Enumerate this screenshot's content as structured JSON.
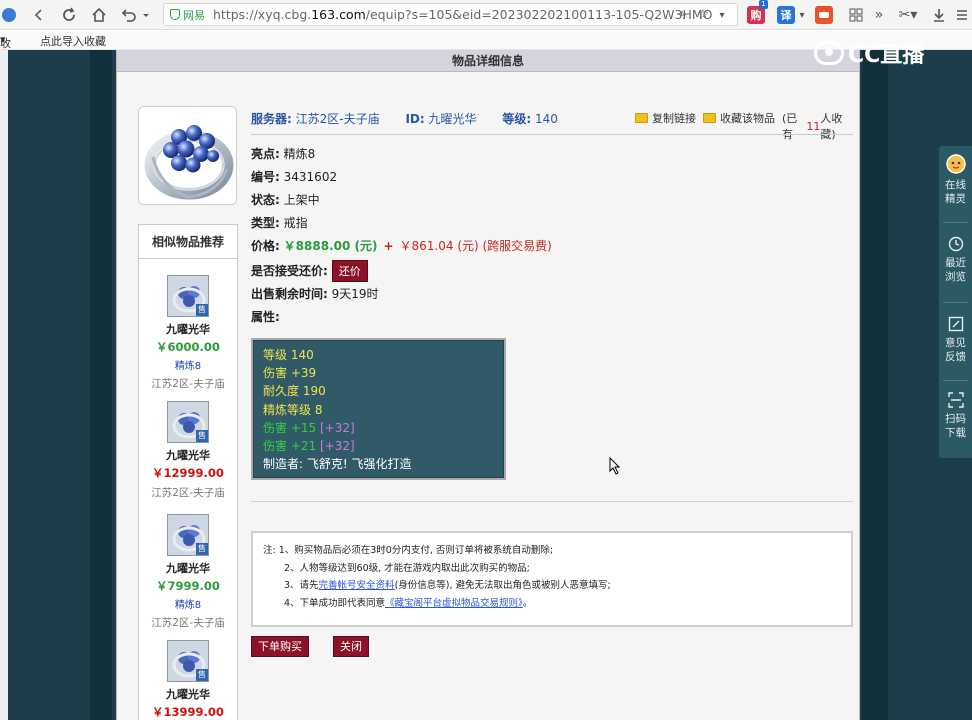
{
  "browser": {
    "url_secure_label": "网易",
    "url_host": "https://xyq.cbg.",
    "url_domain": "163.com",
    "url_path": "/equip?s=105&eid=202302202100113-105-Q2W3HMO",
    "ext_badge": "1",
    "ext_translate": "译",
    "ext_cart": "购"
  },
  "bookmarks": {
    "item1": "收藏",
    "item2": "点此导入收藏"
  },
  "logo": {
    "text": "CC直播"
  },
  "panel": {
    "title": "物品详细信息"
  },
  "item": {
    "server_label": "服务器:",
    "server": "江苏2区-夫子庙",
    "id_label": "ID:",
    "id": "九曜光华",
    "level_label": "等级:",
    "level": "140",
    "copy_link": "复制链接",
    "favorite": "收藏该物品",
    "fav_prefix": "(已有",
    "fav_count": "11",
    "fav_suffix": "人收藏)",
    "highlight_label": "亮点:",
    "highlight": "精炼8",
    "number_label": "编号:",
    "number": "3431602",
    "status_label": "状态:",
    "status": "上架中",
    "type_label": "类型:",
    "type": "戒指",
    "price_label": "价格:",
    "price": "￥8888.00 (元)",
    "plus": "+",
    "fee": "￥861.04 (元) (跨服交易费)",
    "counter_label": "是否接受还价:",
    "counter_button": "还价",
    "remaining_label": "出售剩余时间:",
    "remaining": "9天19时",
    "attributes_label": "属性:"
  },
  "attributes": {
    "level": "等级 140",
    "damage": "伤害 +39",
    "durability": "耐久度 190",
    "refine_level": "精炼等级 8",
    "green1_base": "伤害 +15",
    "green1_extra": "[+32]",
    "green2_base": "伤害 +21",
    "green2_extra": "[+32]",
    "maker": "制造者: 飞舒克! 飞强化打造"
  },
  "notice": {
    "line1": "注: 1、购买物品后必须在3时0分内支付, 否则订单将被系统自动删除;",
    "line2": "2、人物等级达到60级, 才能在游戏内取出此次购买的物品;",
    "line3_prefix": "3、请先",
    "line3_link": "完善帐号安全资料",
    "line3_suffix": "(身份信息等), 避免无法取出角色或被别人恶意填写;",
    "line4_prefix": "4、下单成功即代表同意",
    "line4_link": "《藏宝阁平台虚拟物品交易规则》",
    "line4_suffix": "。"
  },
  "buttons": {
    "buy": "下单购买",
    "close": "关闭"
  },
  "recommendations": {
    "title": "相似物品推荐",
    "sale_tag": "售",
    "items": [
      {
        "name": "九曜光华",
        "price": "￥6000.00",
        "refine": "精炼8",
        "server": "江苏2区-夫子庙"
      },
      {
        "name": "九曜光华",
        "price": "￥12999.00",
        "refine": "",
        "server": "江苏2区-夫子庙"
      },
      {
        "name": "九曜光华",
        "price": "￥7999.00",
        "refine": "精炼8",
        "server": "江苏2区-夫子庙"
      },
      {
        "name": "九曜光华",
        "price": "￥13999.00",
        "refine": "",
        "server": ""
      }
    ]
  },
  "float_bar": {
    "online": "在线精灵",
    "recent": "最近浏览",
    "feedback": "意见反馈",
    "scan": "扫码下载"
  },
  "colors": {
    "page_bg": "#1c3d49",
    "accent_red": "#8b1229",
    "price_green": "#2b9a3c",
    "attr_box": "#305a68"
  }
}
